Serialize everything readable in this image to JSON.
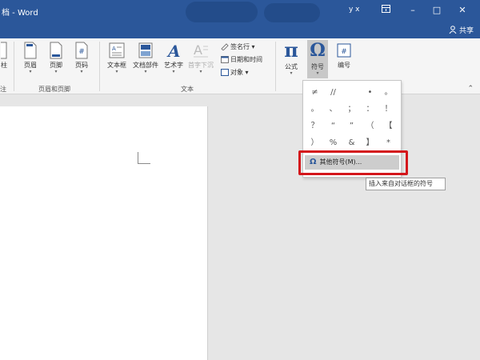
{
  "window": {
    "title": "档 - Word",
    "user": "y x",
    "ribbon_display_icon": "ribbon-display-icon",
    "minimize": "–",
    "maximize": "□",
    "close": "✕",
    "share_label": "共享"
  },
  "ribbon": {
    "partial_left_top": "柱",
    "partial_left_bottom": "注",
    "header_footer": {
      "header_label": "页眉",
      "footer_label": "页脚",
      "page_number_label": "页码",
      "group_label": "页眉和页脚"
    },
    "text": {
      "textbox_label": "文本框",
      "quickparts_label": "文档部件",
      "wordart_label": "艺术字",
      "dropcap_label": "首字下沉",
      "signature_line_label": "签名行",
      "datetime_label": "日期和时间",
      "object_label": "对象",
      "group_label": "文本"
    },
    "symbols": {
      "equation_label": "公式",
      "symbol_label": "符号",
      "number_label": "编号"
    }
  },
  "symbol_dropdown": {
    "symbols": [
      "≠",
      "//",
      "",
      "•",
      "。",
      "。",
      "、",
      "；",
      "：",
      "！",
      "？",
      "“",
      "”",
      "（",
      "【",
      "）",
      "%",
      "&",
      "】",
      "*"
    ],
    "more_symbols_label": "其他符号(M)...",
    "tooltip": "插入来自对话框的符号"
  },
  "colors": {
    "brand": "#2b579a",
    "highlight": "#d4171c"
  }
}
